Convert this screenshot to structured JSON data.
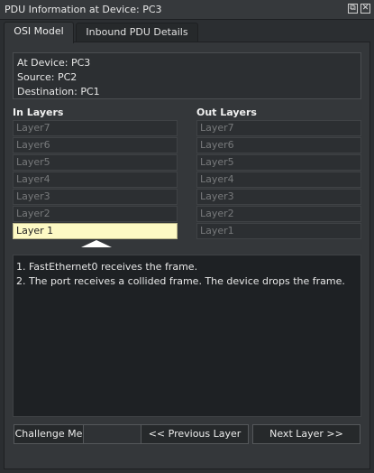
{
  "window": {
    "title": "PDU Information at Device: PC3",
    "float_glyph": "⧉",
    "close_glyph": "✕"
  },
  "tabs": [
    {
      "label": "OSI Model",
      "active": true
    },
    {
      "label": "Inbound PDU Details",
      "active": false
    }
  ],
  "info": {
    "at_device": "At Device: PC3",
    "source": "Source: PC2",
    "destination": "Destination: PC1"
  },
  "in_layers": {
    "heading": "In Layers",
    "items": [
      "Layer7",
      "Layer6",
      "Layer5",
      "Layer4",
      "Layer3",
      "Layer2",
      "Layer 1"
    ],
    "current_index": 6
  },
  "out_layers": {
    "heading": "Out Layers",
    "items": [
      "Layer7",
      "Layer6",
      "Layer5",
      "Layer4",
      "Layer3",
      "Layer2",
      "Layer1"
    ]
  },
  "description": {
    "lines": [
      "1. FastEthernet0 receives the frame.",
      "2. The port receives a collided frame. The device drops the frame."
    ]
  },
  "buttons": {
    "challenge": "Challenge Me",
    "previous": "<< Previous Layer",
    "next": "Next Layer >>"
  },
  "colors": {
    "current_layer_bg": "#fdf9c4",
    "panel_bg": "#34373a",
    "description_bg": "#1e2124"
  }
}
